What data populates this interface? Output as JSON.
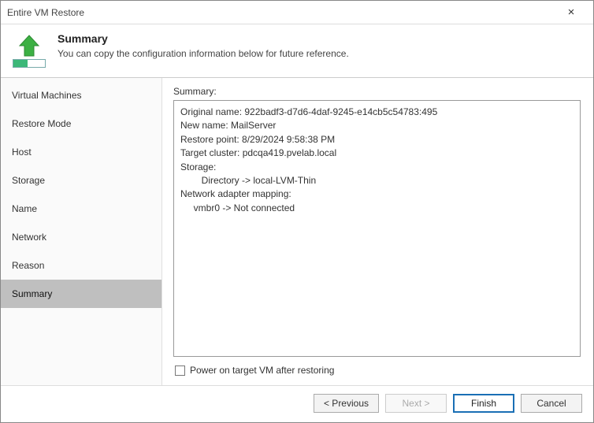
{
  "window": {
    "title": "Entire VM Restore"
  },
  "header": {
    "title": "Summary",
    "subtitle": "You can copy the configuration information below for future reference."
  },
  "sidebar": {
    "items": [
      {
        "label": "Virtual Machines"
      },
      {
        "label": "Restore Mode"
      },
      {
        "label": "Host"
      },
      {
        "label": "Storage"
      },
      {
        "label": "Name"
      },
      {
        "label": "Network"
      },
      {
        "label": "Reason"
      },
      {
        "label": "Summary"
      }
    ],
    "active_index": 7
  },
  "main": {
    "summary_label": "Summary:",
    "summary_lines": [
      "Original name: 922badf3-d7d6-4daf-9245-e14cb5c54783:495",
      "New name: MailServer",
      "Restore point: 8/29/2024 9:58:38 PM",
      "Target cluster: pdcqa419.pvelab.local",
      "Storage:",
      "        Directory -> local-LVM-Thin",
      "Network adapter mapping:",
      "     vmbr0 -> Not connected"
    ],
    "power_on_label": "Power on target VM after restoring",
    "power_on_checked": false
  },
  "footer": {
    "previous": "< Previous",
    "next": "Next >",
    "finish": "Finish",
    "cancel": "Cancel"
  }
}
